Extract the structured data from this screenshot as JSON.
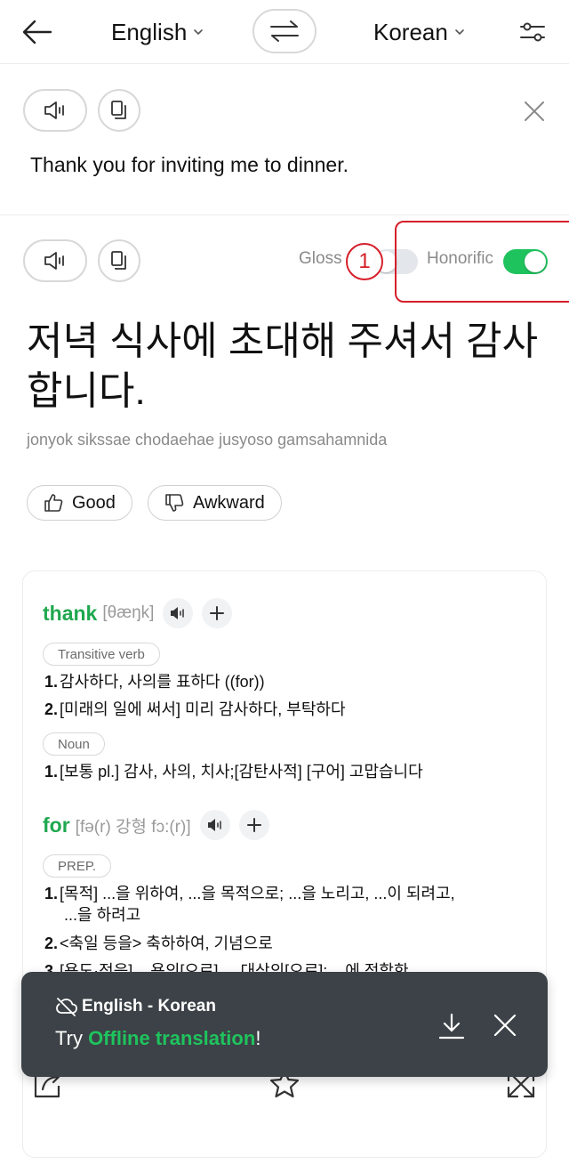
{
  "header": {
    "source_lang": "English",
    "target_lang": "Korean"
  },
  "source": {
    "text": "Thank you for inviting me to dinner."
  },
  "toggles": {
    "gloss_label": "Gloss",
    "gloss_on": false,
    "honorific_label": "Honorific",
    "honorific_on": true
  },
  "annotation": {
    "marker": "1"
  },
  "translation": {
    "text": "저녁 식사에 초대해 주셔서 감사합니다.",
    "romanization": "jonyok sikssae chodaehae jusyoso gamsahamnida"
  },
  "feedback": {
    "good_label": "Good",
    "awkward_label": "Awkward"
  },
  "dictionary": {
    "entries": [
      {
        "word": "thank",
        "pron": "[θæŋk]",
        "groups": [
          {
            "pos": "Transitive verb",
            "defs": [
              {
                "num": "1.",
                "text": "감사하다, 사의를 표하다 ((for))"
              },
              {
                "num": "2.",
                "text": "[미래의 일에 써서] 미리 감사하다, 부탁하다"
              }
            ]
          },
          {
            "pos": "Noun",
            "defs": [
              {
                "num": "1.",
                "text": "[보통 pl.] 감사, 사의, 치사;[감탄사적] [구어] 고맙습니다"
              }
            ]
          }
        ]
      },
      {
        "word": "for",
        "pron": "[fə(r) 강형 fɔ:(r)]",
        "groups": [
          {
            "pos": "PREP.",
            "defs": [
              {
                "num": "1.",
                "text": "[목적] ...을 위하여, ...을 목적으로; ...을 노리고, ...이 되려고,",
                "cont": "...을 하려고"
              },
              {
                "num": "2.",
                "text": "<축일 등을> 축하하여, 기념으로"
              },
              {
                "num": "3.",
                "text": "[용도·적응] ...용의[으로], ...대상의[으로]; ...에 적합한"
              }
            ]
          }
        ]
      }
    ]
  },
  "toast": {
    "title": "English - Korean",
    "body_prefix": "Try ",
    "body_highlight": "Offline translation",
    "body_suffix": "!"
  },
  "colors": {
    "accent_green": "#1fc35d",
    "headword_green": "#1fa84f",
    "annotation_red": "#d61f2a",
    "toast_bg": "#3c4247"
  }
}
